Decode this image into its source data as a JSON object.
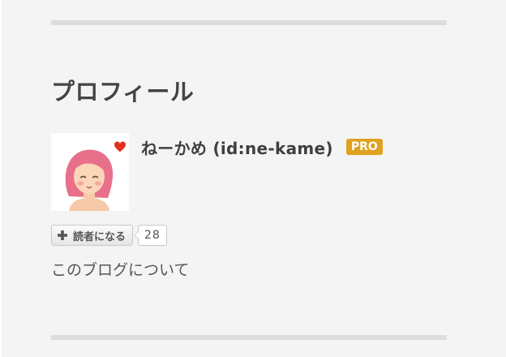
{
  "profile_module": {
    "title": "プロフィール",
    "avatar": {
      "icon": "woman-avatar-with-heart-icon",
      "hair_color": "#e8708a",
      "heart_color": "#e0321e"
    },
    "username": "ねーかめ (id:ne-kame)",
    "pro_badge": "PRO",
    "subscribe": {
      "icon": "plus-icon",
      "label": "読者になる",
      "count": "28"
    },
    "about_link": "このブログについて"
  },
  "colors": {
    "panel_bg": "#f4f4f4",
    "divider": "#dddddd",
    "badge": "#e0a021",
    "title_text": "#444444"
  }
}
